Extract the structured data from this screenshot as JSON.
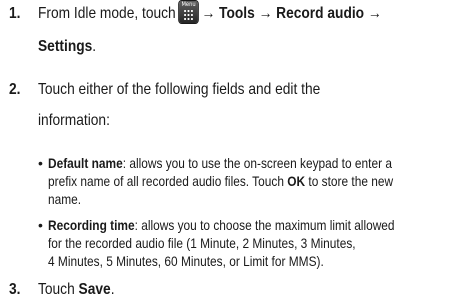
{
  "step1": {
    "number": "1.",
    "text_before_icon": "From Idle mode, touch",
    "menu_key_label": "Menu",
    "arrow1": "→",
    "tools": "Tools",
    "arrow2": "→",
    "record_audio": "Record audio",
    "arrow3": "→",
    "settings": "Settings",
    "period": "."
  },
  "step2": {
    "number": "2.",
    "line1": "Touch either of the following fields and edit the",
    "line2": "information:"
  },
  "bullet_default_name": {
    "dot": "•",
    "term": "Default name",
    "line1_rest": ": allows you to use the on-screen keypad to enter a",
    "line2_before_ok": "prefix name of all recorded audio files. Touch",
    "ok": "OK",
    "line2_after_ok": "to store the new",
    "line3": "name."
  },
  "bullet_recording_time": {
    "dot": "•",
    "term": "Recording time",
    "line1_rest": ": allows you to choose the maximum limit allowed",
    "line2": "for the recorded audio file (1 Minute, 2 Minutes, 3 Minutes,",
    "line3": "4 Minutes, 5 Minutes, 60 Minutes, or Limit for MMS)."
  },
  "step3": {
    "number": "3.",
    "text": "Touch",
    "save": "Save",
    "period": "."
  }
}
